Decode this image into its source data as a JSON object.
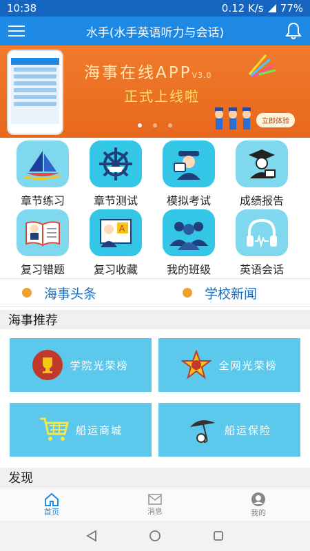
{
  "status": {
    "time": "10:38",
    "speed": "0.12 K/s",
    "battery": "77%"
  },
  "appbar": {
    "title": "水手(水手英语听力与会话)"
  },
  "banner": {
    "title": "海事在线APP",
    "version": "V3.0",
    "subtitle": "正式上线啦",
    "cta": "立即体验",
    "slide_index": 1,
    "slide_count": 3
  },
  "grid": [
    {
      "label": "章节练习",
      "icon": "sailboat-icon"
    },
    {
      "label": "章节测试",
      "icon": "ship-wheel-icon"
    },
    {
      "label": "模拟考试",
      "icon": "examiner-icon"
    },
    {
      "label": "成绩报告",
      "icon": "graduate-icon"
    },
    {
      "label": "复习错题",
      "icon": "open-book-icon"
    },
    {
      "label": "复习收藏",
      "icon": "reading-icon"
    },
    {
      "label": "我的班级",
      "icon": "class-group-icon"
    },
    {
      "label": "英语会话",
      "icon": "headphones-icon"
    }
  ],
  "news": {
    "left": "海事头条",
    "right": "学校新闻"
  },
  "recommend": {
    "title": "海事推荐",
    "cards": [
      {
        "label": "学院光荣榜",
        "icon": "trophy-icon"
      },
      {
        "label": "全网光荣榜",
        "icon": "star-badge-icon"
      },
      {
        "label": "船运商城",
        "icon": "shopping-cart-icon"
      },
      {
        "label": "船运保险",
        "icon": "umbrella-icon"
      }
    ]
  },
  "discover": {
    "title": "发现"
  },
  "bottom_nav": [
    {
      "label": "首页",
      "icon": "home-icon",
      "active": true
    },
    {
      "label": "消息",
      "icon": "mail-icon",
      "active": false
    },
    {
      "label": "我的",
      "icon": "profile-icon",
      "active": false
    }
  ],
  "colors": {
    "primary": "#1e88e5",
    "banner": "#e8681c",
    "tile": "#7fd8ee",
    "card": "#5bc8ec",
    "accent_dot": "#f0a030"
  }
}
